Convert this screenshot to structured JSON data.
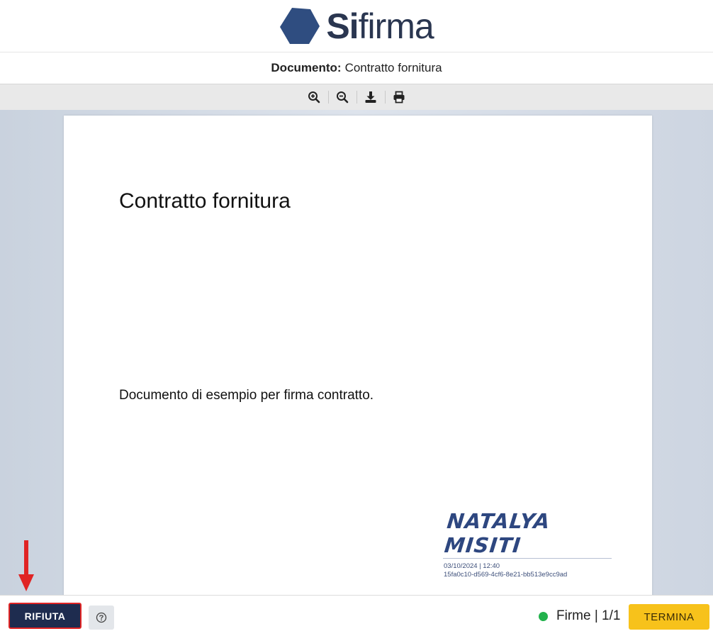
{
  "brand": {
    "name_bold": "Si",
    "name_light": "firma",
    "color": "#2a3650",
    "logo_mark_color": "#2f4d80"
  },
  "document": {
    "label": "Documento:",
    "name": "Contratto fornitura"
  },
  "toolbar": {
    "icons": [
      "zoom-in-icon",
      "zoom-out-icon",
      "download-icon",
      "print-icon"
    ]
  },
  "page": {
    "heading": "Contratto fornitura",
    "body": "Documento di esempio per firma contratto.",
    "signature": {
      "name": "NATALYA MISITI",
      "timestamp": "03/10/2024 | 12:40",
      "id": "15fa0c10-d569-4cf6-8e21-bb513e9cc9ad"
    }
  },
  "footer": {
    "refuse_label": "RIFIUTA",
    "help_icon": "question-circle-icon",
    "status_label": "Firme | 1/1",
    "status_color": "#22b24c",
    "finish_label": "TERMINA",
    "finish_color": "#f7c21b",
    "refuse_color": "#1e2c4f"
  },
  "annotation": {
    "arrow_color": "#e02424"
  }
}
